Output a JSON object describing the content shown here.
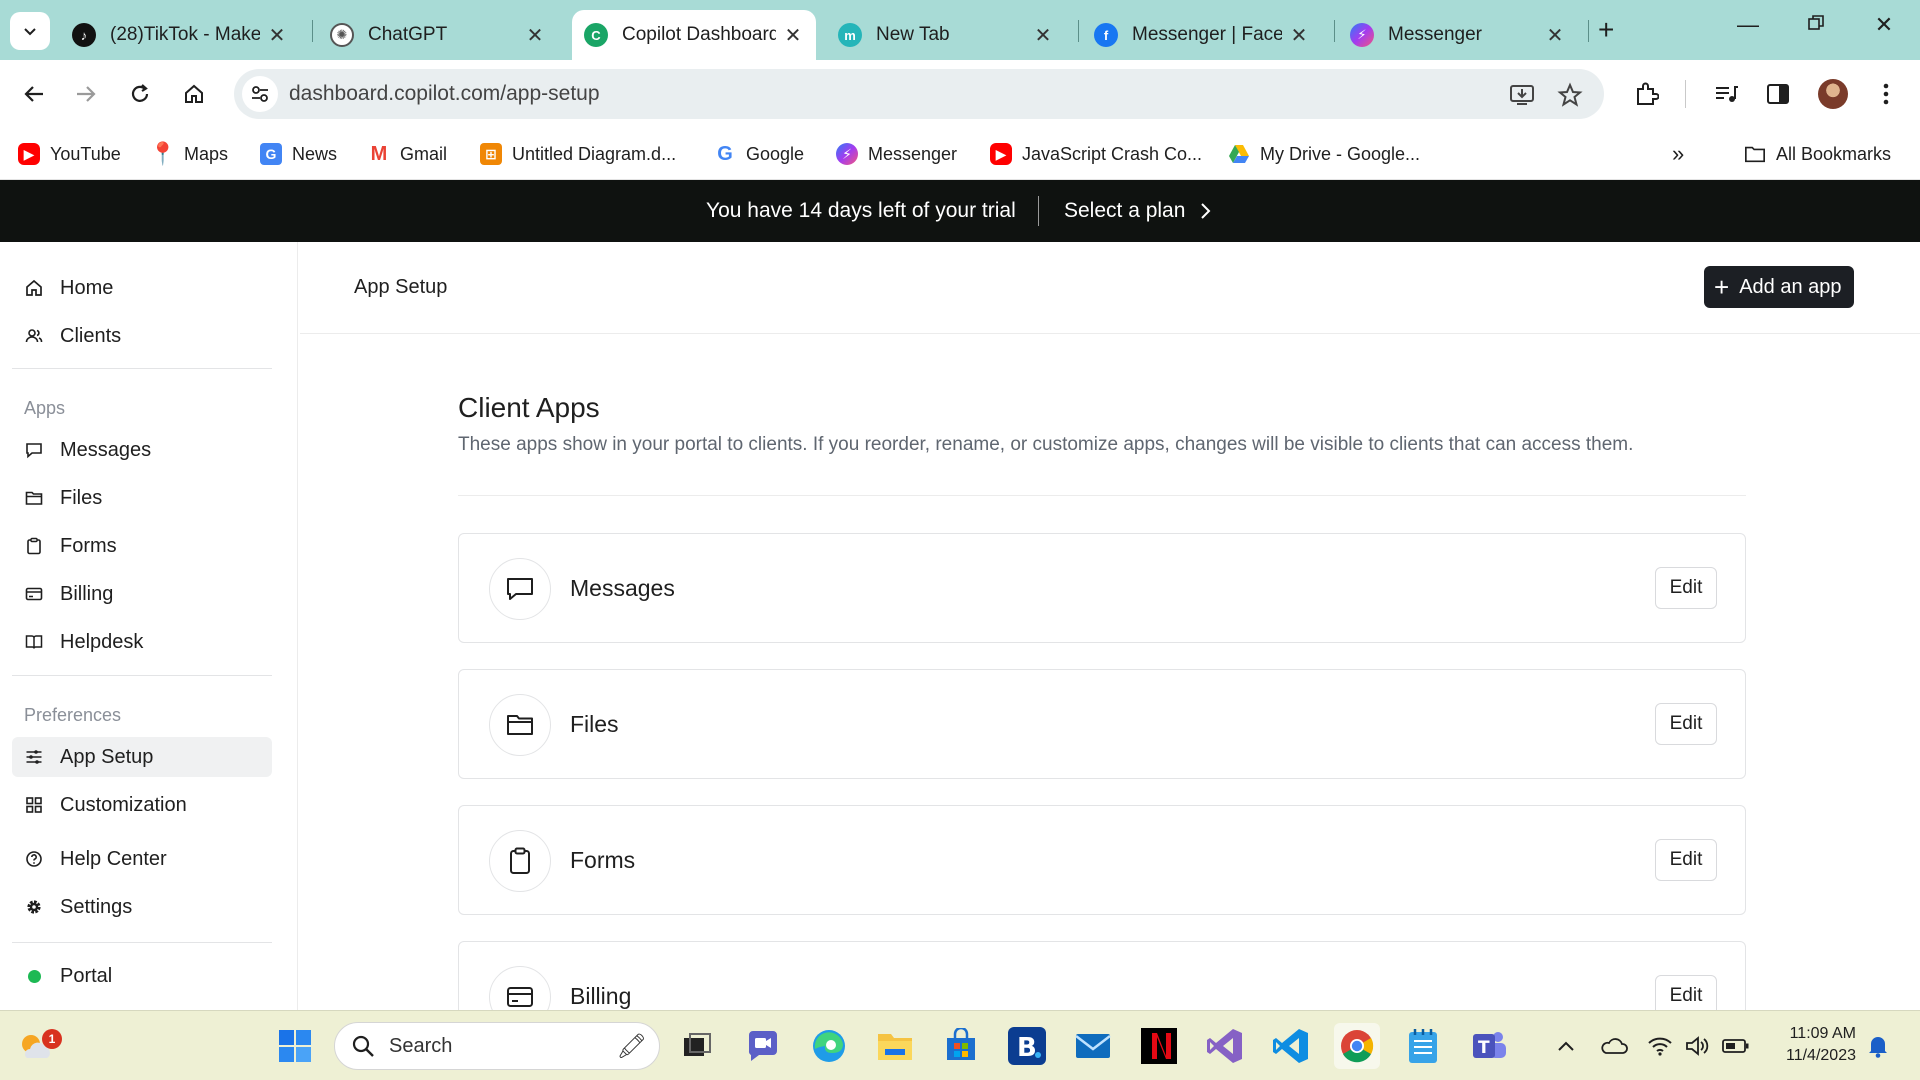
{
  "browser": {
    "tabs": [
      {
        "title": "(28)TikTok - Make",
        "favicon": "tiktok-icon",
        "active": false
      },
      {
        "title": "ChatGPT",
        "favicon": "chatgpt-icon",
        "active": false
      },
      {
        "title": "Copilot Dashboard",
        "favicon": "copilot-icon",
        "active": true
      },
      {
        "title": "New Tab",
        "favicon": "new-tab-icon",
        "active": false
      },
      {
        "title": "Messenger | Facebook",
        "favicon": "facebook-icon",
        "active": false
      },
      {
        "title": "Messenger",
        "favicon": "messenger-icon",
        "active": false
      }
    ],
    "url": "dashboard.copilot.com/app-setup",
    "bookmarks": [
      {
        "label": "YouTube",
        "icon": "youtube-icon"
      },
      {
        "label": "Maps",
        "icon": "maps-icon"
      },
      {
        "label": "News",
        "icon": "news-icon"
      },
      {
        "label": "Gmail",
        "icon": "gmail-icon"
      },
      {
        "label": "Untitled Diagram.d...",
        "icon": "drawio-icon"
      },
      {
        "label": "Google",
        "icon": "google-icon"
      },
      {
        "label": "Messenger",
        "icon": "messenger-icon"
      },
      {
        "label": "JavaScript Crash Co...",
        "icon": "youtube-icon"
      },
      {
        "label": "My Drive - Google...",
        "icon": "drive-icon"
      }
    ],
    "all_bookmarks": "All Bookmarks"
  },
  "banner": {
    "trial_text": "You have 14 days left of your trial",
    "select_plan": "Select a plan"
  },
  "sidebar": {
    "top_items": [
      {
        "label": "Home",
        "icon": "home-icon"
      },
      {
        "label": "Clients",
        "icon": "users-icon"
      }
    ],
    "apps_heading": "Apps",
    "app_items": [
      {
        "label": "Messages",
        "icon": "chat-bubble-icon"
      },
      {
        "label": "Files",
        "icon": "folder-icon"
      },
      {
        "label": "Forms",
        "icon": "clipboard-icon"
      },
      {
        "label": "Billing",
        "icon": "credit-card-icon"
      },
      {
        "label": "Helpdesk",
        "icon": "book-icon"
      }
    ],
    "preferences_heading": "Preferences",
    "pref_items": [
      {
        "label": "App Setup",
        "icon": "sliders-icon",
        "active": true
      },
      {
        "label": "Customization",
        "icon": "grid-icon"
      }
    ],
    "help_items": [
      {
        "label": "Help Center",
        "icon": "help-circle-icon"
      },
      {
        "label": "Settings",
        "icon": "gear-icon"
      }
    ],
    "portal": {
      "label": "Portal",
      "status_color": "#1db954"
    }
  },
  "main": {
    "page_title": "App Setup",
    "add_app_label": "Add an app",
    "section_title": "Client Apps",
    "section_desc": "These apps show in your portal to clients. If you reorder, rename, or customize apps, changes will be visible to clients that can access them.",
    "apps": [
      {
        "name": "Messages",
        "icon": "chat-bubble-icon",
        "edit_label": "Edit"
      },
      {
        "name": "Files",
        "icon": "folder-icon",
        "edit_label": "Edit"
      },
      {
        "name": "Forms",
        "icon": "clipboard-icon",
        "edit_label": "Edit"
      },
      {
        "name": "Billing",
        "icon": "credit-card-icon",
        "edit_label": "Edit"
      }
    ]
  },
  "taskbar": {
    "search_placeholder": "Search",
    "notification_count": "1",
    "time": "11:09 AM",
    "date": "11/4/2023"
  },
  "colors": {
    "tabstrip": "#a8dbd6",
    "banner": "#0f1210",
    "primary_button": "#1c1f24",
    "portal_status": "#1db954"
  }
}
